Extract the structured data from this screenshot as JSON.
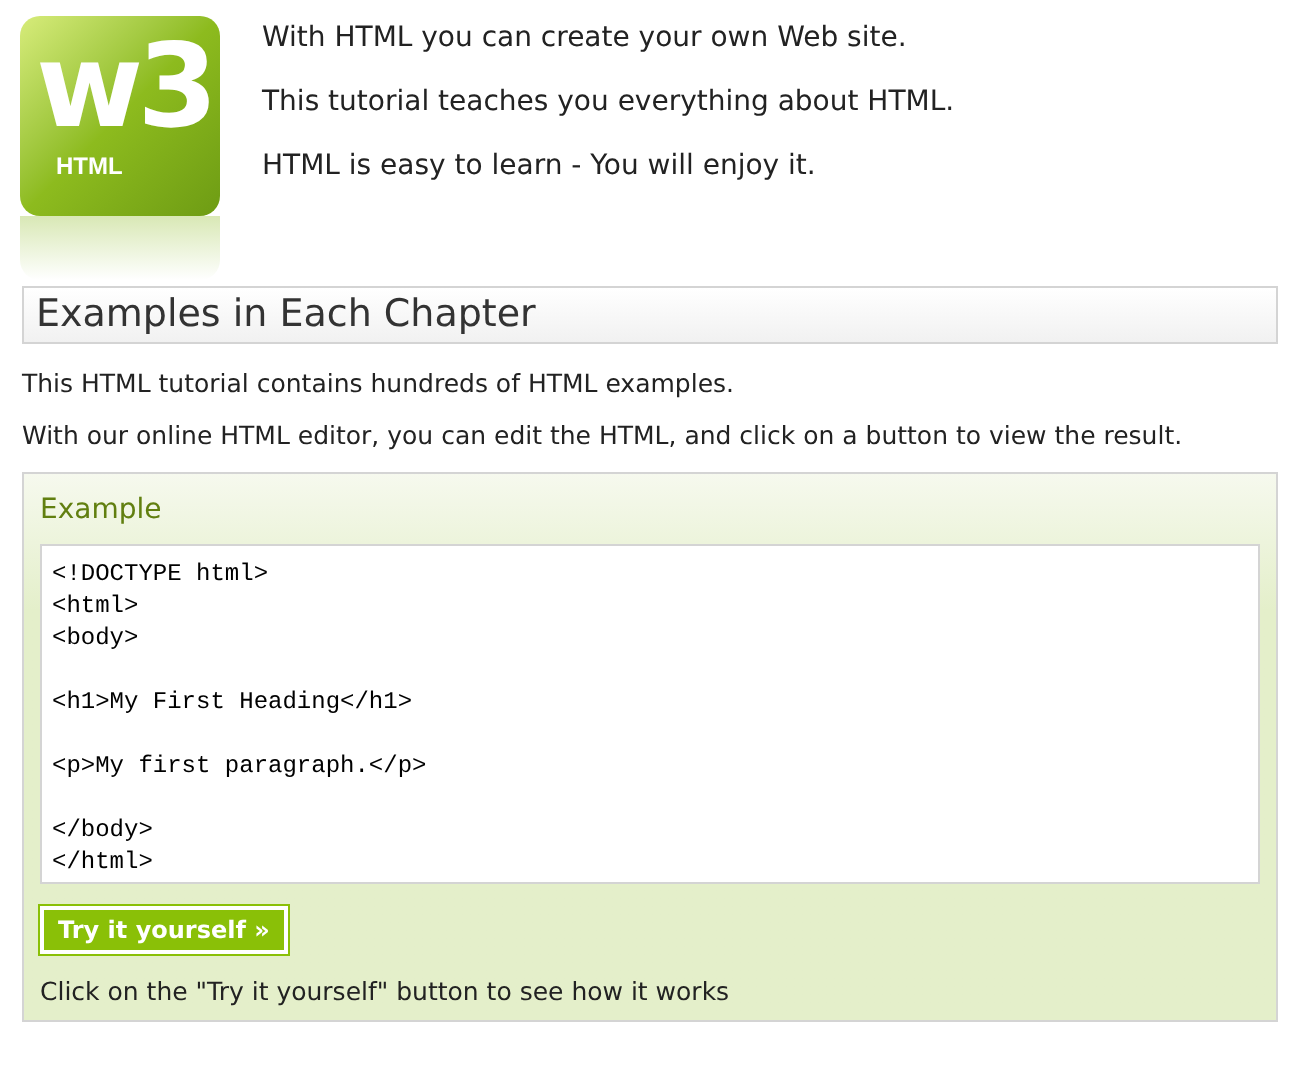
{
  "logo": {
    "mark": "w3",
    "label": "HTML"
  },
  "intro": [
    "With HTML you can create your own Web site.",
    "This tutorial teaches you everything about HTML.",
    "HTML is easy to learn - You will enjoy it."
  ],
  "section": {
    "heading": "Examples in Each Chapter",
    "paragraphs": [
      "This HTML tutorial contains hundreds of HTML examples.",
      "With our online HTML editor, you can edit the HTML, and click on a button to view the result."
    ]
  },
  "example": {
    "title": "Example",
    "code": "<!DOCTYPE html>\n<html>\n<body>\n\n<h1>My First Heading</h1>\n\n<p>My first paragraph.</p>\n\n</body>\n</html>",
    "button": "Try it yourself »",
    "note": "Click on the \"Try it yourself\" button to see how it works"
  }
}
